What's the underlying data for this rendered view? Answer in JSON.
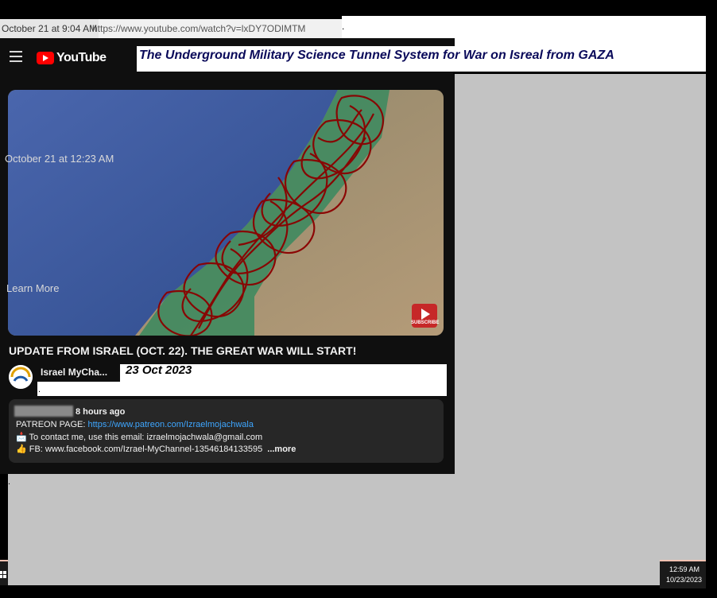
{
  "browser": {
    "timestamp_overlay": "October 21 at 9:04 AM",
    "url": "https://www.youtube.com/watch?v=lxDY7ODIMTM",
    "dot": "."
  },
  "header": {
    "brand": "YouTube",
    "banner_title": "The Underground Military Science Tunnel System for War on Isreal from GAZA"
  },
  "video": {
    "overlay_timestamp": "October 21 at 12:23 AM",
    "overlay_learn_more": "Learn More",
    "subscribe_label": "SUBSCRIBE",
    "title": "UPDATE FROM ISRAEL (OCT. 22). THE GREAT WAR WILL START!",
    "channel_name": "Israel MyCha...",
    "annotation_date": "23 Oct 2023",
    "annotation_dot": "."
  },
  "description": {
    "time_ago": "8 hours ago",
    "patreon_label": "PATREON PAGE: ",
    "patreon_link": "https://www.patreon.com/Izraelmojachwala",
    "contact_line": "📩 To contact me, use this email: izraelmojachwala@gmail.com",
    "fb_line": "👍 FB: www.facebook.com/Izrael-MyChannel-13546184133595",
    "more_label": "...more"
  },
  "page": {
    "bottom_dot": "."
  },
  "taskbar": {
    "time": "12:59 AM",
    "date": "10/23/2023"
  },
  "colors": {
    "youtube_red": "#ff0000",
    "link_blue": "#3ea6ff",
    "background_dark": "#0f0f0f",
    "tunnel_red": "#8b0000",
    "sea_blue": "#3a5ba0",
    "gaza_green": "#3f8a5f"
  }
}
